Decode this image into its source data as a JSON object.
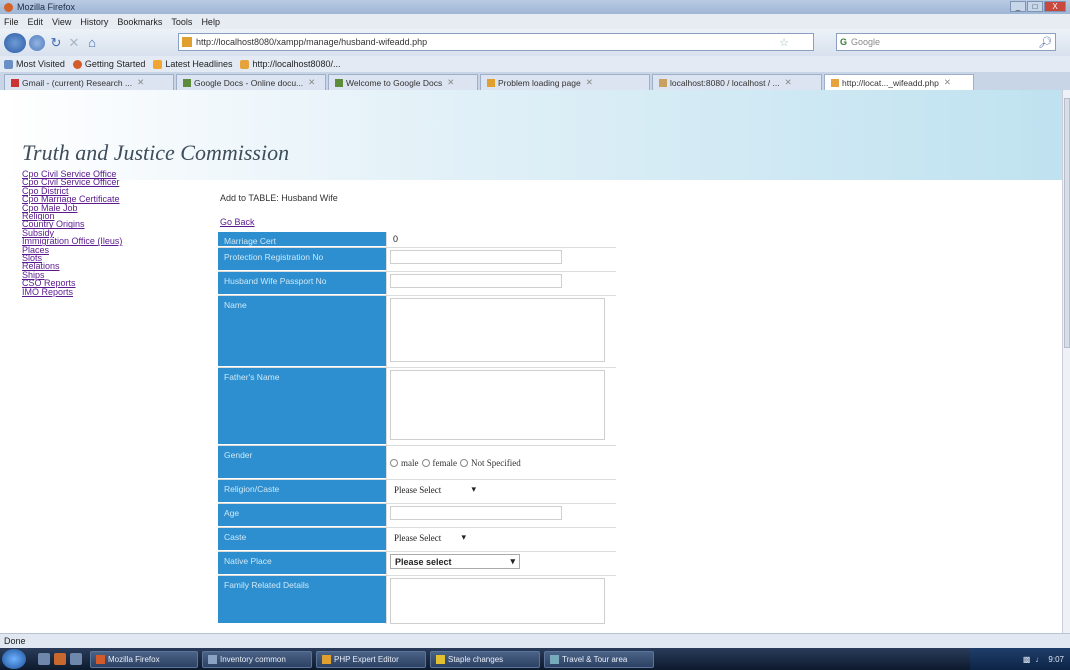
{
  "window": {
    "title": "Mozilla Firefox",
    "buttons": [
      "_",
      "□",
      "X"
    ]
  },
  "menubar": [
    "File",
    "Edit",
    "View",
    "History",
    "Bookmarks",
    "Tools",
    "Help"
  ],
  "navbar": {
    "url": "http://localhost8080/xampp/manage/husband-wifeadd.php",
    "search_placeholder": "Google",
    "search_engine_badge": "G"
  },
  "bookmarks": [
    "Most Visited",
    "Getting Started",
    "Latest Headlines",
    "http://localhost8080/..."
  ],
  "tabs": [
    {
      "label": "Gmail - (current) Research ...",
      "active": false
    },
    {
      "label": "Google Docs - Online docu...",
      "active": false
    },
    {
      "label": "Welcome to Google Docs",
      "active": false
    },
    {
      "label": "Problem loading page",
      "active": false
    },
    {
      "label": "localhost:8080 / localhost / ...",
      "active": false
    },
    {
      "label": "http://locat..._wifeadd.php",
      "active": true
    }
  ],
  "page": {
    "site_title": "Truth and Justice Commission",
    "nav_links": [
      "Cpo Civil Service Office",
      "Cpo Civil Service Officer",
      "Cpo District",
      "Cpo Marriage Certificate",
      "Cpo Male Job",
      "Religion",
      "Country Origins",
      "Subsidy",
      "Immigration Office (Ileus)",
      "Places",
      "Slots",
      "Relations",
      "Ships",
      "CSO Reports",
      "IMO Reports"
    ],
    "form_heading": "Add to TABLE: Husband Wife",
    "go_back": "Go Back",
    "fields": [
      {
        "label": "Marriage Cert",
        "value": "0"
      },
      {
        "label": "Protection Registration No",
        "value": ""
      },
      {
        "label": "Husband Wife Passport No",
        "value": ""
      },
      {
        "label": "Name",
        "value": ""
      },
      {
        "label": "Father's Name",
        "value": ""
      },
      {
        "label": "Gender",
        "options": [
          "male",
          "female",
          "Not Specified"
        ]
      },
      {
        "label": "Religion/Caste",
        "select": "Please Select"
      },
      {
        "label": "Age",
        "value": ""
      },
      {
        "label": "Caste",
        "select": "Please Select"
      },
      {
        "label": "Native Place",
        "select": "Please select"
      },
      {
        "label": "Family Related Details",
        "value": ""
      }
    ]
  },
  "statusbar": {
    "text": "Done"
  },
  "taskbar": {
    "items": [
      "Mozilla Firefox",
      "Inventory common",
      "PHP Expert Editor",
      "Staple changes",
      "Travel & Tour area"
    ],
    "clock": "9:07"
  }
}
